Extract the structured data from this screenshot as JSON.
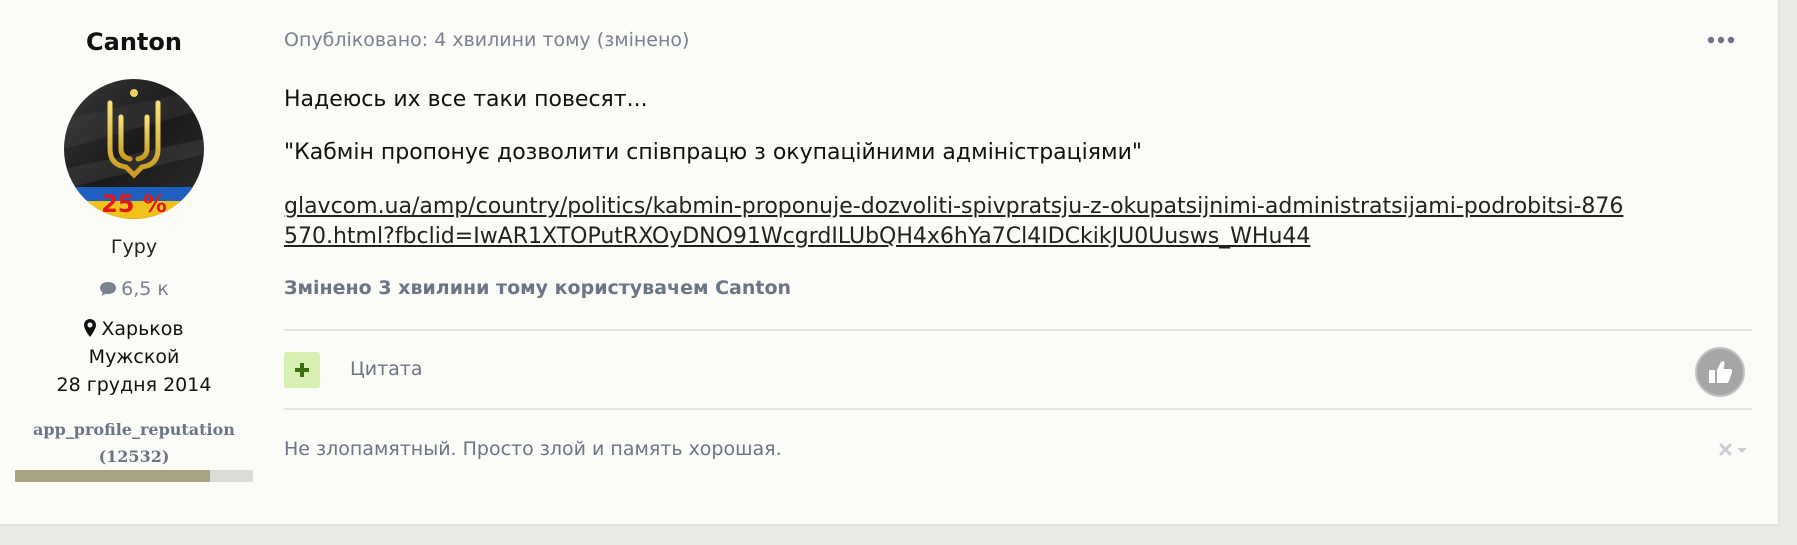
{
  "author": {
    "name": "Canton",
    "title": "Гуру",
    "posts": "6,5 к",
    "location": "Харьков",
    "gender": "Мужской",
    "joined": "28 грудня 2014",
    "reputation_label": "app_profile_reputation",
    "reputation_count": "(12532)",
    "reputation_fill_percent": 82,
    "avatar_badge": "25 %"
  },
  "post": {
    "meta": "Опубліковано: 4 хвилини тому (змінено)",
    "paragraph_1": "Надеюсь их все таки повесят...",
    "paragraph_2": "\"Кабмін пропонує дозволити співпрацю з окупаційними адміністраціями\"",
    "link_text": "glavcom.ua/amp/country/politics/kabmin-proponuje-dozvoliti-spivpratsju-z-okupatsijnimi-administratsijami-podrobitsi-876570.html?fbclid=IwAR1XTOPutRXOyDNO91WcgrdILUbQH4x6hYa7Cl4IDCkikJU0Uusws_WHu44",
    "edited_note": "Змінено 3 хвилини тому користувачем Canton",
    "quote_label": "Цитата",
    "signature": "Не злопамятный. Просто злой и память хорошая."
  },
  "icons": {
    "more": "ellipsis-icon",
    "posts": "comment-icon",
    "location": "map-marker-icon",
    "plus": "plus-icon",
    "like": "thumbs-up-icon",
    "signature_close": "close-icon",
    "signature_menu": "caret-down-icon"
  },
  "colors": {
    "background": "#ebebe6",
    "card": "#fbfbf7",
    "muted_text": "#7a8190",
    "plus_button_bg": "#d8f0b4",
    "reputation_bar": "#a8a482",
    "like_button_bg": "#a6a6a6"
  }
}
